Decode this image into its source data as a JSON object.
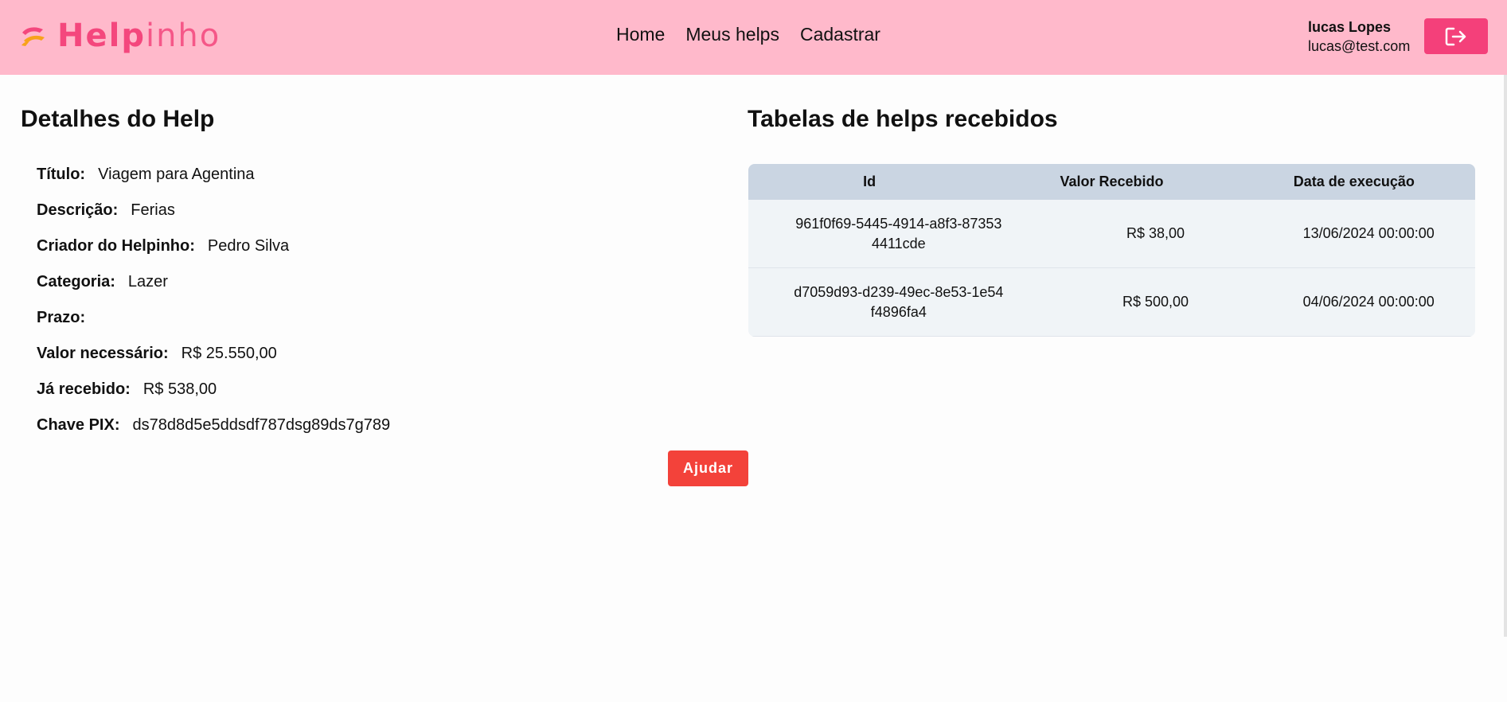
{
  "app": {
    "logo_bold": "Help",
    "logo_light": "inho",
    "logo_mid": "p"
  },
  "nav": [
    {
      "label": "Home"
    },
    {
      "label": "Meus helps"
    },
    {
      "label": "Cadastrar"
    }
  ],
  "user": {
    "name": "lucas Lopes",
    "email": "lucas@test.com",
    "logout_icon": "logout-icon"
  },
  "details": {
    "heading": "Detalhes do Help",
    "rows": [
      {
        "label": "Título:",
        "value": "Viagem para Agentina"
      },
      {
        "label": "Descrição:",
        "value": "Ferias"
      },
      {
        "label": "Criador do Helpinho:",
        "value": "Pedro Silva"
      },
      {
        "label": "Categoria:",
        "value": "Lazer"
      },
      {
        "label": "Prazo:",
        "value": ""
      },
      {
        "label": "Valor necessário:",
        "value": "R$ 25.550,00"
      },
      {
        "label": "Já recebido:",
        "value": "R$ 538,00"
      },
      {
        "label": "Chave PIX:",
        "value": "ds78d8d5e5ddsdf787dsg89ds7g789"
      }
    ],
    "help_button": "Ajudar"
  },
  "received": {
    "heading": "Tabelas de helps recebidos",
    "columns": [
      "Id",
      "Valor Recebido",
      "Data de execução"
    ],
    "rows": [
      [
        "961f0f69-5445-4914-a8f3-873534411cde",
        "R$ 38,00",
        "13/06/2024 00:00:00"
      ],
      [
        "d7059d93-d239-49ec-8e53-1e54f4896fa4",
        "R$ 500,00",
        "04/06/2024 00:00:00"
      ]
    ]
  },
  "colors": {
    "header_bg": "#ffb9cb",
    "brand": "#f4477d",
    "logout_bg": "#f4407a",
    "help_button_bg": "#f3423a",
    "table_header_bg": "#cad5e2"
  }
}
